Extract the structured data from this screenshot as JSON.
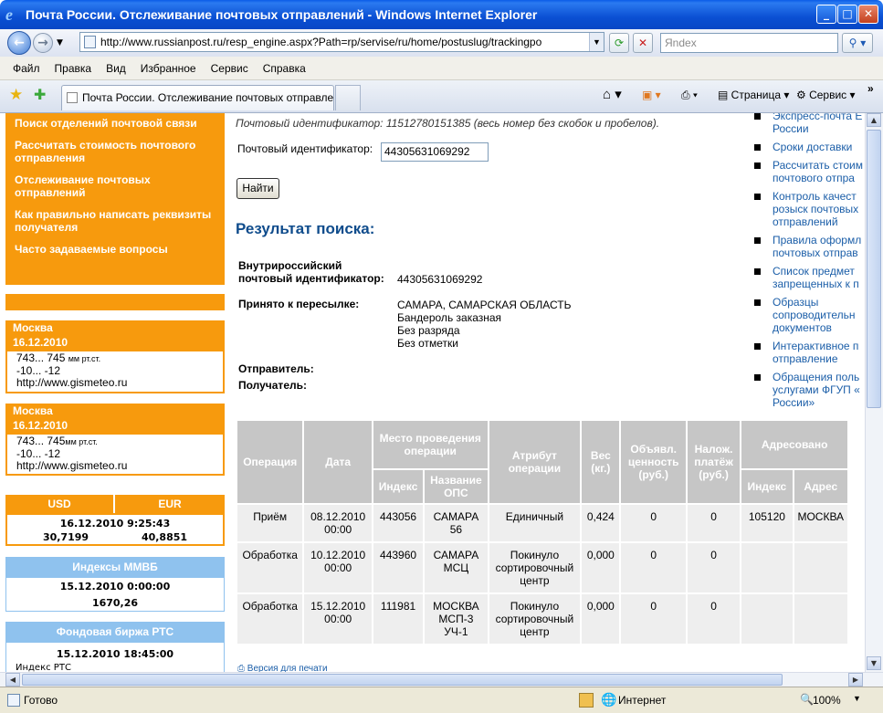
{
  "window": {
    "title": "Почта России. Отслеживание почтовых отправлений - Windows Internet Explorer",
    "minimize": "_",
    "maximize": "□",
    "close": "✕"
  },
  "address": {
    "url": "http://www.russianpost.ru/resp_engine.aspx?Path=rp/servise/ru/home/postuslug/trackingpo",
    "search_placeholder": "Яndex"
  },
  "menu": [
    "Файл",
    "Правка",
    "Вид",
    "Избранное",
    "Сервис",
    "Справка"
  ],
  "tab": {
    "title": "Почта России. Отслеживание почтовых отправле...",
    "page_label": "Страница",
    "tools_label": "Сервис"
  },
  "sidebar": {
    "links": [
      "Поиск отделений почтовой связи",
      "Рассчитать стоимость почтового отправления",
      "Отслеживание почтовых отправлений",
      "Как правильно написать реквизиты получателя",
      "Часто задаваемые вопросы"
    ],
    "weather": [
      {
        "city": "Москва",
        "date": "16.12.2010",
        "pressure": "743... 745",
        "unit": "мм рт.ст.",
        "temp": "-10... -12",
        "site": "http://www.gismeteo.ru"
      },
      {
        "city": "Москва",
        "date": "16.12.2010",
        "pressure": "743... 745",
        "unit": "мм рт.ст.",
        "temp": "-10... -12",
        "site": "http://www.gismeteo.ru"
      }
    ],
    "currency": {
      "usd_label": "USD",
      "eur_label": "EUR",
      "datetime": "16.12.2010 9:25:43",
      "usd": "30,7199",
      "eur": "40,8851"
    },
    "micex": {
      "title": "Индексы ММВБ",
      "datetime": "15.12.2010 0:00:00",
      "value": "1670,26"
    },
    "rts": {
      "title": "Фондовая биржа РТС",
      "datetime": "15.12.2010 18:45:00",
      "label": "Индекс РТС"
    }
  },
  "main": {
    "hint": "Почтовый идентификатор: 11512780151385 (весь номер без скобок и пробелов).",
    "id_label": "Почтовый идентификатор:",
    "id_value": "44305631069292",
    "find_button": "Найти",
    "result_title": "Результат поиска:",
    "domestic_label_1": "Внутрироссийский",
    "domestic_label_2": "почтовый идентификатор:",
    "domestic_value": "44305631069292",
    "accepted_label": "Принято к пересылке:",
    "accepted_lines": [
      "САМАРА, САМАРСКАЯ ОБЛАСТЬ",
      "Бандероль заказная",
      "Без разряда",
      "Без отметки"
    ],
    "sender_label": "Отправитель:",
    "recipient_label": "Получатель:",
    "print_link": "Версия для печати"
  },
  "table": {
    "headers": {
      "operation": "Операция",
      "date": "Дата",
      "place": "Место проведения операции",
      "index": "Индекс",
      "ops_name": "Название ОПС",
      "attribute": "Атрибут операции",
      "weight": "Вес (кг.)",
      "declared": "Объявл. ценность (руб.)",
      "cod": "Налож. платёж (руб.)",
      "addressed": "Адресовано",
      "addr_index": "Индекс",
      "addr_address": "Адрес"
    },
    "rows": [
      {
        "operation": "Приём",
        "date": "08.12.2010 00:00",
        "index": "443056",
        "ops": "САМАРА 56",
        "attribute": "Единичный",
        "weight": "0,424",
        "declared": "0",
        "cod": "0",
        "addr_index": "105120",
        "addr": "МОСКВА"
      },
      {
        "operation": "Обработка",
        "date": "10.12.2010 00:00",
        "index": "443960",
        "ops": "САМАРА МСЦ",
        "attribute": "Покинуло сортировочный центр",
        "weight": "0,000",
        "declared": "0",
        "cod": "0",
        "addr_index": "",
        "addr": ""
      },
      {
        "operation": "Обработка",
        "date": "15.12.2010 00:00",
        "index": "111981",
        "ops": "МОСКВА МСП-3 УЧ-1",
        "attribute": "Покинуло сортировочный центр",
        "weight": "0,000",
        "declared": "0",
        "cod": "0",
        "addr_index": "",
        "addr": ""
      }
    ]
  },
  "rightcol": [
    "Экспресс-почта Е|России",
    "Сроки доставки",
    "Рассчитать стоим|почтового отпра",
    "Контроль качест|розыск почтовых|отправлений",
    "Правила оформл|почтовых отправ",
    "Список предмет|запрещенных к п",
    "Образцы|сопроводительн|документов",
    "Интерактивное п|отправление",
    "Обращения поль|услугами ФГУП «|России»"
  ],
  "status": {
    "text": "Готово",
    "zone": "Интернет",
    "zoom": "100%"
  },
  "colors": {
    "orange": "#f79a0d",
    "blue_header": "#8fc2ee",
    "result_title": "#0f4c8c",
    "link": "#1b5ea8"
  }
}
